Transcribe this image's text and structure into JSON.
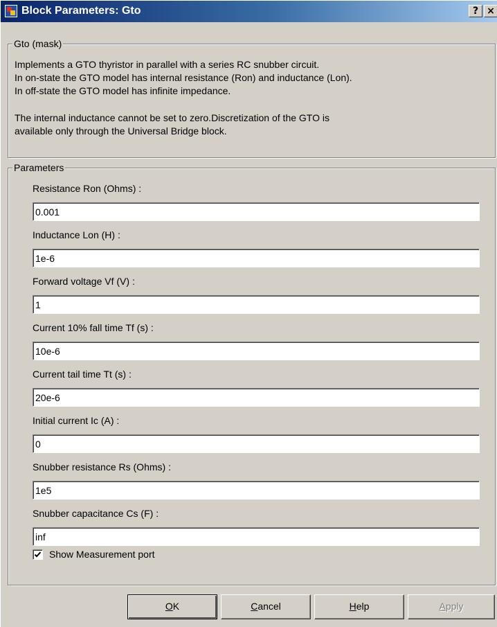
{
  "window": {
    "title": "Block Parameters: Gto",
    "help_glyph": "?",
    "close_glyph": "×"
  },
  "mask_group": {
    "legend": "Gto (mask)",
    "lines": [
      "Implements a GTO thyristor in parallel with a series RC snubber circuit.",
      "In on-state the GTO model has internal resistance (Ron) and inductance (Lon).",
      "In off-state the GTO model has infinite impedance.",
      "The internal inductance cannot be set to zero.Discretization of the GTO is",
      "available only through the Universal Bridge block."
    ]
  },
  "params_group": {
    "legend": "Parameters",
    "fields": [
      {
        "label": "Resistance Ron (Ohms) :",
        "value": "0.001"
      },
      {
        "label": "Inductance Lon (H) :",
        "value": "1e-6"
      },
      {
        "label": "Forward voltage Vf (V) :",
        "value": "1"
      },
      {
        "label": "Current 10% fall time Tf (s) :",
        "value": "10e-6"
      },
      {
        "label": "Current tail time Tt (s) :",
        "value": "20e-6"
      },
      {
        "label": "Initial current Ic (A) :",
        "value": "0"
      },
      {
        "label": "Snubber resistance Rs (Ohms) :",
        "value": "1e5"
      },
      {
        "label": "Snubber capacitance Cs (F) :",
        "value": "inf"
      }
    ],
    "checkbox": {
      "label": "Show Measurement port",
      "checked": true
    }
  },
  "buttons": {
    "ok": {
      "mnemonic": "O",
      "rest": "K"
    },
    "cancel": {
      "mnemonic": "C",
      "rest": "ancel"
    },
    "help": {
      "mnemonic": "H",
      "rest": "elp"
    },
    "apply": {
      "mnemonic": "A",
      "rest": "pply",
      "enabled": false
    }
  },
  "colors": {
    "titlebar_start": "#0a246a",
    "titlebar_end": "#a6caf0",
    "dialog_bg": "#d4d0c8"
  }
}
